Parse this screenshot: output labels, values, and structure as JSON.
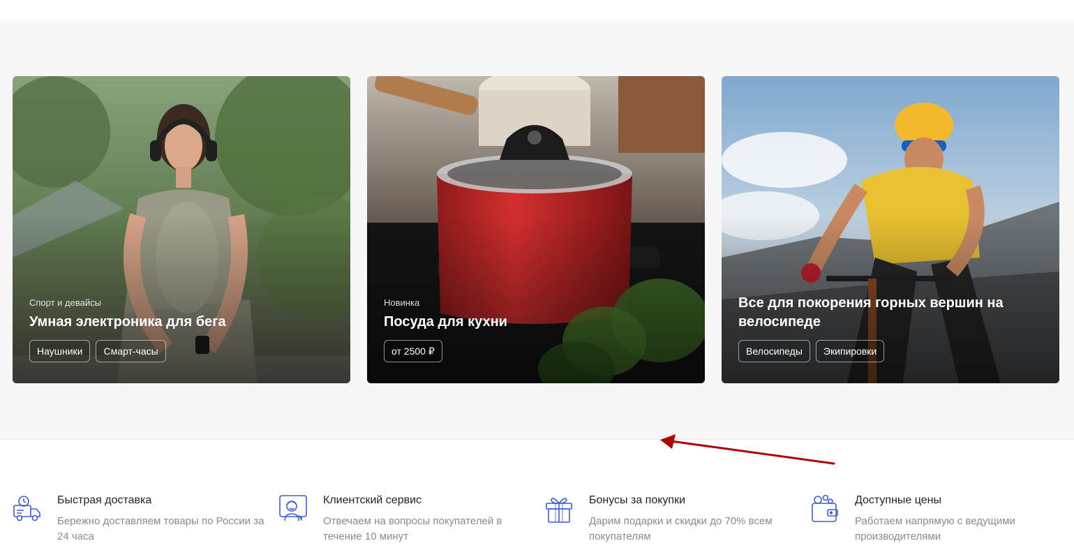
{
  "promo_cards": [
    {
      "eyebrow": "Спорт и девайсы",
      "title": "Умная электроника для бега",
      "chips": [
        "Наушники",
        "Смарт-часы"
      ]
    },
    {
      "eyebrow": "Новинка",
      "title": "Посуда для кухни",
      "chips": [
        "от 2500 ₽"
      ]
    },
    {
      "eyebrow": "",
      "title": "Все для покорения горных вершин на велосипеде",
      "chips": [
        "Велосипеды",
        "Экипировки"
      ]
    }
  ],
  "features": [
    {
      "icon": "delivery-truck-clock-icon",
      "title": "Быстрая доставка",
      "desc": "Бережно доставляем товары по России за 24 часа"
    },
    {
      "icon": "support-agent-icon",
      "title": "Клиентский сервис",
      "desc": "Отвечаем на вопросы покупателей в течение 10 минут"
    },
    {
      "icon": "gift-icon",
      "title": "Бонусы за покупки",
      "desc": "Дарим подарки и скидки до 70% всем покупателям"
    },
    {
      "icon": "wallet-icon",
      "title": "Доступные цены",
      "desc": "Работаем напрямую с ведущими производителями"
    }
  ],
  "colors": {
    "accent": "#3b5bdb",
    "annotation_arrow": "#b00000",
    "section_bg": "#f7f7f7"
  }
}
